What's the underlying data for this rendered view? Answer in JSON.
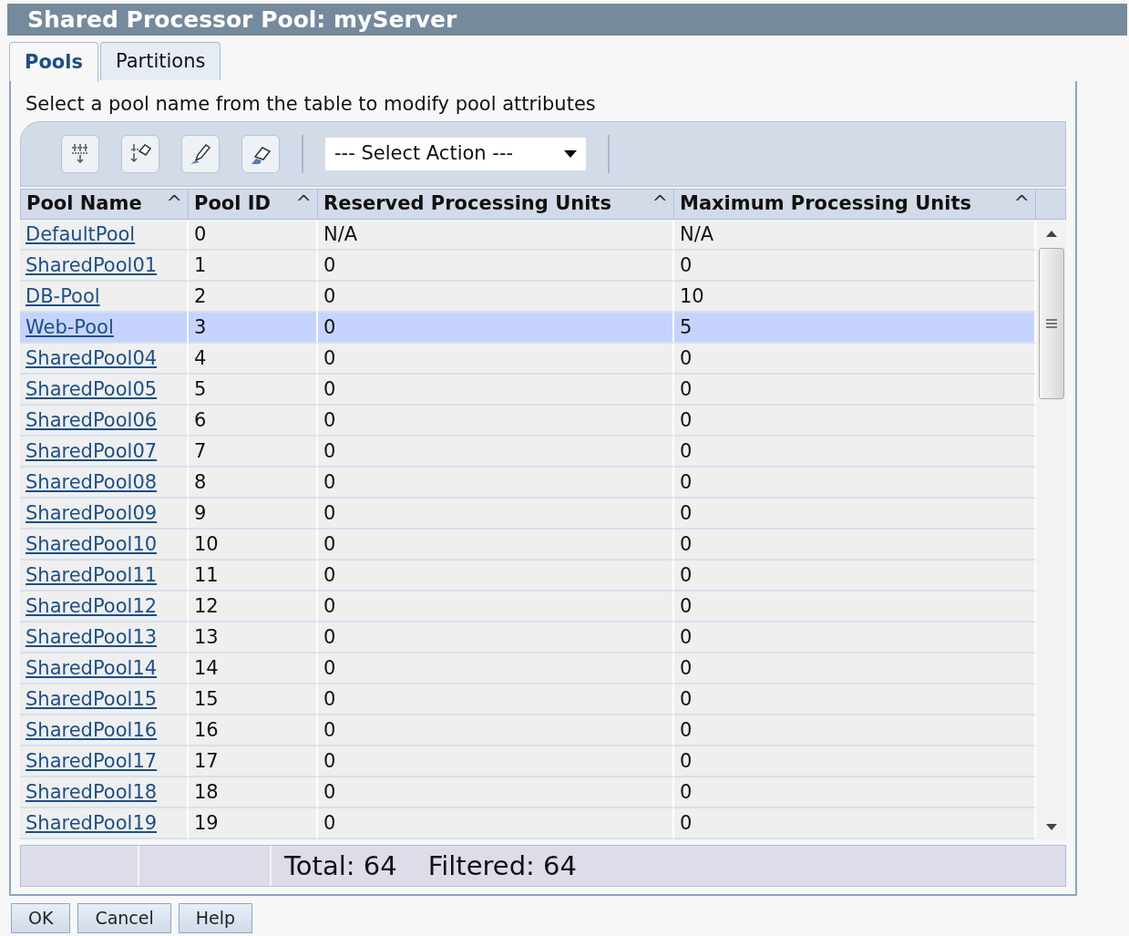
{
  "window": {
    "title": "Shared Processor Pool: myServer"
  },
  "tabs": [
    {
      "label": "Pools",
      "selected": true
    },
    {
      "label": "Partitions",
      "selected": false
    }
  ],
  "instruction": "Select a pool name from the table to modify pool attributes",
  "toolbar": {
    "tools": [
      {
        "kind": "filter-rows"
      },
      {
        "kind": "filter-edit"
      },
      {
        "kind": "edit"
      },
      {
        "kind": "clear"
      }
    ],
    "action_select": {
      "value": "--- Select Action ---"
    }
  },
  "table": {
    "columns": [
      {
        "label": "Pool Name",
        "sort_mark": "^"
      },
      {
        "label": "Pool ID",
        "sort_mark": "^"
      },
      {
        "label": "Reserved Processing Units",
        "sort_mark": "^"
      },
      {
        "label": "Maximum Processing Units",
        "sort_mark": "^"
      }
    ],
    "rows": [
      {
        "name": "DefaultPool",
        "id": "0",
        "reserved": "N/A",
        "maximum": "N/A",
        "selected": false
      },
      {
        "name": "SharedPool01",
        "id": "1",
        "reserved": "0",
        "maximum": "0",
        "selected": false
      },
      {
        "name": "DB-Pool",
        "id": "2",
        "reserved": "0",
        "maximum": "10",
        "selected": false
      },
      {
        "name": "Web-Pool",
        "id": "3",
        "reserved": "0",
        "maximum": "5",
        "selected": true
      },
      {
        "name": "SharedPool04",
        "id": "4",
        "reserved": "0",
        "maximum": "0",
        "selected": false
      },
      {
        "name": "SharedPool05",
        "id": "5",
        "reserved": "0",
        "maximum": "0",
        "selected": false
      },
      {
        "name": "SharedPool06",
        "id": "6",
        "reserved": "0",
        "maximum": "0",
        "selected": false
      },
      {
        "name": "SharedPool07",
        "id": "7",
        "reserved": "0",
        "maximum": "0",
        "selected": false
      },
      {
        "name": "SharedPool08",
        "id": "8",
        "reserved": "0",
        "maximum": "0",
        "selected": false
      },
      {
        "name": "SharedPool09",
        "id": "9",
        "reserved": "0",
        "maximum": "0",
        "selected": false
      },
      {
        "name": "SharedPool10",
        "id": "10",
        "reserved": "0",
        "maximum": "0",
        "selected": false
      },
      {
        "name": "SharedPool11",
        "id": "11",
        "reserved": "0",
        "maximum": "0",
        "selected": false
      },
      {
        "name": "SharedPool12",
        "id": "12",
        "reserved": "0",
        "maximum": "0",
        "selected": false
      },
      {
        "name": "SharedPool13",
        "id": "13",
        "reserved": "0",
        "maximum": "0",
        "selected": false
      },
      {
        "name": "SharedPool14",
        "id": "14",
        "reserved": "0",
        "maximum": "0",
        "selected": false
      },
      {
        "name": "SharedPool15",
        "id": "15",
        "reserved": "0",
        "maximum": "0",
        "selected": false
      },
      {
        "name": "SharedPool16",
        "id": "16",
        "reserved": "0",
        "maximum": "0",
        "selected": false
      },
      {
        "name": "SharedPool17",
        "id": "17",
        "reserved": "0",
        "maximum": "0",
        "selected": false
      },
      {
        "name": "SharedPool18",
        "id": "18",
        "reserved": "0",
        "maximum": "0",
        "selected": false
      },
      {
        "name": "SharedPool19",
        "id": "19",
        "reserved": "0",
        "maximum": "0",
        "selected": false
      }
    ],
    "footer": {
      "total": "Total: 64",
      "filtered": "Filtered: 64"
    }
  },
  "buttons": [
    "OK",
    "Cancel",
    "Help"
  ]
}
